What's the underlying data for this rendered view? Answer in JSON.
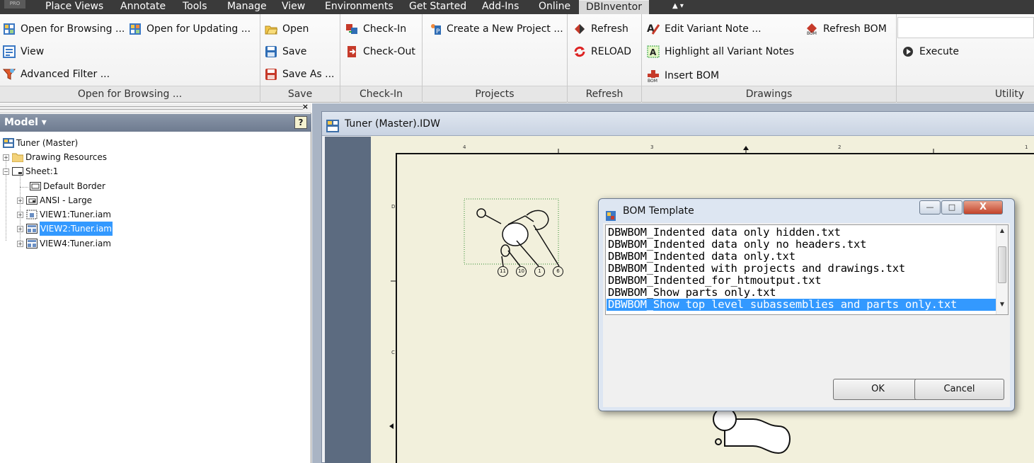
{
  "menubar": {
    "pro_badge": "PRO",
    "tabs": [
      "Place Views",
      "Annotate",
      "Tools",
      "Manage",
      "View",
      "Environments",
      "Get Started",
      "Add-Ins",
      "Online",
      "DBInventor"
    ],
    "active_tab": "DBInventor",
    "quick_access": "▲ ▾"
  },
  "ribbon": {
    "open_for_browsing": {
      "buttons": [
        "Open for Browsing ...",
        "Open for Updating ...",
        "View",
        "Advanced Filter ..."
      ],
      "label": "Open for Browsing ..."
    },
    "save": {
      "buttons": [
        "Open",
        "Save",
        "Save As ..."
      ],
      "label": "Save"
    },
    "checkin": {
      "buttons": [
        "Check-In",
        "Check-Out"
      ],
      "label": "Check-In"
    },
    "projects": {
      "buttons": [
        "Create a New Project ..."
      ],
      "label": "Projects"
    },
    "refresh": {
      "buttons": [
        "Refresh",
        "RELOAD"
      ],
      "label": "Refresh"
    },
    "drawings": {
      "buttons": [
        "Edit Variant Note ...",
        "Refresh BOM",
        "Highlight all Variant Notes",
        "Insert BOM"
      ],
      "label": "Drawings"
    },
    "utility": {
      "buttons": [
        "Execute"
      ],
      "label": "Utility"
    }
  },
  "panel": {
    "title": "Model ▾",
    "help": "?",
    "close": "×",
    "tree": [
      {
        "label": "Tuner (Master)",
        "selected": false
      },
      {
        "label": "Drawing Resources",
        "selected": false
      },
      {
        "label": "Sheet:1",
        "selected": false
      },
      {
        "label": "Default Border",
        "selected": false
      },
      {
        "label": "ANSI - Large",
        "selected": false
      },
      {
        "label": "VIEW1:Tuner.iam",
        "selected": false
      },
      {
        "label": "VIEW2:Tuner.iam",
        "selected": true
      },
      {
        "label": "VIEW4:Tuner.iam",
        "selected": false
      }
    ]
  },
  "document": {
    "title": "Tuner (Master).IDW",
    "ruler_top": [
      "4",
      "3",
      "2",
      "1"
    ],
    "ruler_left": [
      "D",
      "C"
    ],
    "balloons": [
      "11",
      "10",
      "1",
      "6"
    ]
  },
  "dialog": {
    "title": "BOM Template",
    "items": [
      "DBWBOM_Indented data only hidden.txt",
      "DBWBOM_Indented data only no headers.txt",
      "DBWBOM_Indented data only.txt",
      "DBWBOM_Indented with projects and drawings.txt",
      "DBWBOM_Indented_for_htmoutput.txt",
      "DBWBOM_Show parts only.txt",
      "DBWBOM_Show top level subassemblies and parts only.txt"
    ],
    "selected_index": 6,
    "ok_label": "OK",
    "cancel_label": "Cancel",
    "win_buttons": [
      "—",
      "□",
      "X"
    ]
  },
  "colors": {
    "menubar": "#3a3a3a",
    "selection": "#3399ff",
    "sheet": "#f2f0dc",
    "panel_header": "#7a869a"
  }
}
